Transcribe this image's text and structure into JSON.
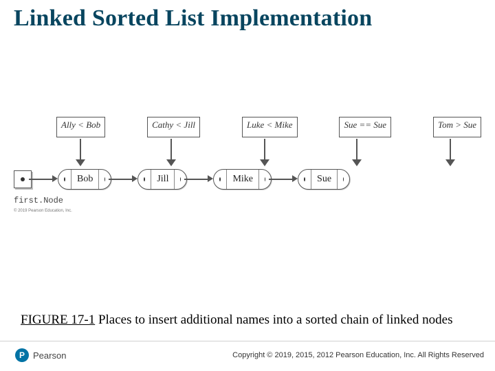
{
  "title": "Linked Sorted List Implementation",
  "comparisons": [
    "Ally < Bob",
    "Cathy < Jill",
    "Luke < Mike",
    "Sue == Sue",
    "Tom > Sue"
  ],
  "nodes": [
    "Bob",
    "Jill",
    "Mike",
    "Sue"
  ],
  "first_node_label": "first.Node",
  "tiny_copyright": "© 2019 Pearson Education, Inc.",
  "caption": {
    "fignum": "FIGURE 17-1",
    "text": " Places to insert additional names into a sorted chain of linked nodes"
  },
  "footer": {
    "brand": "Pearson",
    "brand_initial": "P",
    "copyright": "Copyright © 2019, 2015, 2012 Pearson Education, Inc. All Rights Reserved"
  },
  "chart_data": {
    "type": "table",
    "title": "Linked sorted list insertion points",
    "existing_chain": [
      "Bob",
      "Jill",
      "Mike",
      "Sue"
    ],
    "insertion_tests": [
      {
        "candidate": "Ally",
        "compared_to": "Bob",
        "relation": "<",
        "insert_before": "Bob"
      },
      {
        "candidate": "Cathy",
        "compared_to": "Jill",
        "relation": "<",
        "insert_before": "Jill"
      },
      {
        "candidate": "Luke",
        "compared_to": "Mike",
        "relation": "<",
        "insert_before": "Mike"
      },
      {
        "candidate": "Sue",
        "compared_to": "Sue",
        "relation": "==",
        "insert_before": "Sue"
      },
      {
        "candidate": "Tom",
        "compared_to": "Sue",
        "relation": ">",
        "insert_after": "Sue"
      }
    ]
  }
}
